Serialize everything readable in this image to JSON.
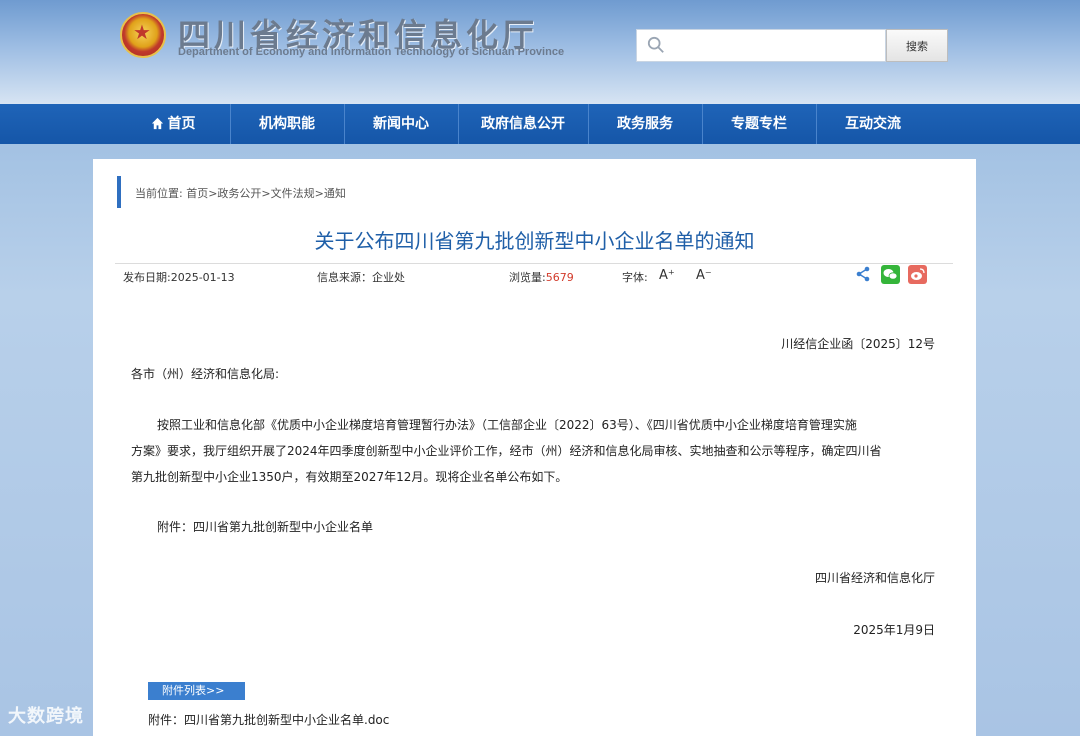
{
  "header": {
    "title": "四川省经济和信息化厅",
    "subtitle": "Department of Economy and Information Technology of Sichuan Province",
    "search_placeholder": "",
    "search_button": "搜索"
  },
  "nav": {
    "items": [
      "首页",
      "机构职能",
      "新闻中心",
      "政府信息公开",
      "政务服务",
      "专题专栏",
      "互动交流"
    ]
  },
  "breadcrumb": "当前位置: 首页>政务公开>文件法规>通知",
  "doc": {
    "title": "关于公布四川省第九批创新型中小企业名单的通知",
    "publish_date": "发布日期:2025-01-13",
    "source": "信息来源：企业处",
    "views_label": "浏览量:",
    "views": "5679",
    "font_label": "字体:",
    "font_up": "A⁺",
    "font_down": "A⁻",
    "doc_number": "川经信企业函〔2025〕12号",
    "salutation": "各市（州）经济和信息化局:",
    "para1_line1": "按照工业和信息化部《优质中小企业梯度培育管理暂行办法》（工信部企业〔2022〕63号）、《四川省优质中小企业梯度培育管理实施",
    "para1_line2": "方案》要求，我厅组织开展了2024年四季度创新型中小企业评价工作，经市（州）经济和信息化局审核、实地抽查和公示等程序，确定四川省",
    "para1_line3": "第九批创新型中小企业1350户，有效期至2027年12月。现将企业名单公布如下。",
    "attachment_note": "附件：四川省第九批创新型中小企业名单",
    "signature": "四川省经济和信息化厅",
    "sign_date": "2025年1月9日"
  },
  "attachments": {
    "tag": "附件列表>>",
    "file": "附件：四川省第九批创新型中小企业名单.doc"
  },
  "watermark": "大数跨境"
}
